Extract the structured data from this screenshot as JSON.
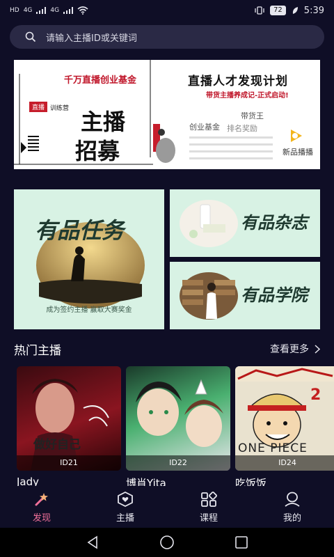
{
  "status": {
    "left_labels": [
      "HD",
      "4G",
      "HD",
      "4G"
    ],
    "battery": "72",
    "time": "5:39"
  },
  "search": {
    "placeholder": "请输入主播ID或关键词"
  },
  "banner": {
    "title": "直播人才发现计划",
    "subtitle": "带货主播养成记-正式启动!",
    "big_left_1": "主播",
    "big_left_2": "招募",
    "red_left": "千万直播创业基金",
    "tag_live": "直播",
    "tag_train": "训练营",
    "word_create": "创业基金",
    "word_king": "带货王",
    "word_rank": "排名奖励",
    "brand": "新品播播"
  },
  "cards": [
    {
      "title": "有品任务",
      "caption": "成为签约主播  赢取大赛奖金"
    },
    {
      "title": "有品杂志"
    },
    {
      "title": "有品学院"
    }
  ],
  "hot": {
    "title": "热门主播",
    "more": "查看更多"
  },
  "streamers": [
    {
      "id": "ID21",
      "name": "Jady",
      "overlay": "做好自己"
    },
    {
      "id": "ID22",
      "name": "博肖Yita"
    },
    {
      "id": "ID24",
      "name": "吃饭饭",
      "overlay": "ONE PIECE"
    }
  ],
  "tabs": [
    {
      "label": "发现",
      "icon": "discover-icon",
      "active": true
    },
    {
      "label": "主播",
      "icon": "streamer-icon",
      "active": false
    },
    {
      "label": "课程",
      "icon": "course-icon",
      "active": false
    },
    {
      "label": "我的",
      "icon": "profile-icon",
      "active": false
    }
  ],
  "colors": {
    "background": "#0f0e26",
    "search_bg": "#2a2945",
    "card_bg": "#d8f2e4",
    "active_tab": "#f0709a"
  }
}
